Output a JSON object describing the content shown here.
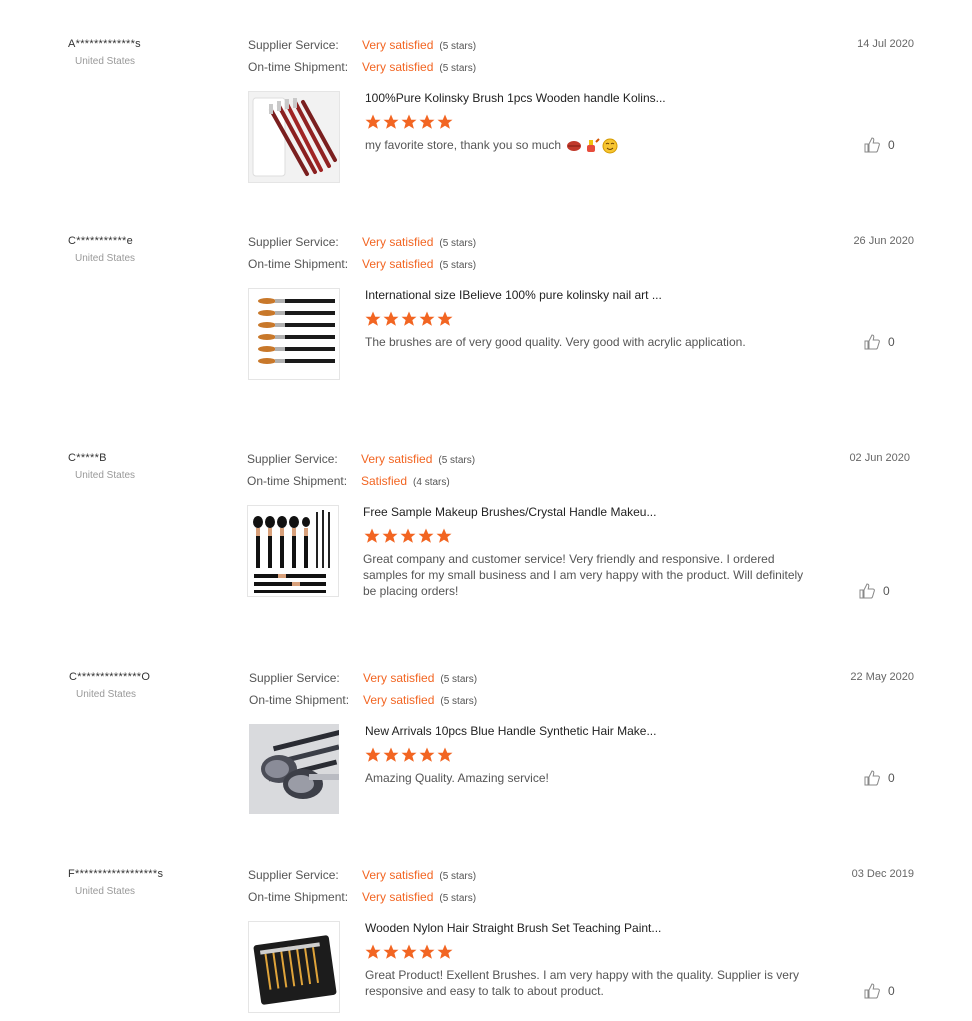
{
  "labels": {
    "supplier_service": "Supplier Service:",
    "on_time_shipment": "On-time Shipment:"
  },
  "colors": {
    "accent": "#f26522",
    "text": "#555555",
    "muted": "#999999"
  },
  "reviews": [
    {
      "buyer": "A*************s",
      "country": "United States",
      "date": "14 Jul 2020",
      "supplier_service": "Very satisfied",
      "supplier_service_stars": "(5 stars)",
      "shipment": "Very satisfied",
      "shipment_stars": "(5 stars)",
      "product_title": "100%Pure Kolinsky Brush 1pcs Wooden handle Kolins...",
      "rating": 5,
      "comment": "my favorite store, thank you so much",
      "comment_emojis": [
        "lips-emoji",
        "nail-polish-emoji",
        "blush-emoji"
      ],
      "helpful_count": "0"
    },
    {
      "buyer": "C***********e",
      "country": "United States",
      "date": "26 Jun 2020",
      "supplier_service": "Very satisfied",
      "supplier_service_stars": "(5 stars)",
      "shipment": "Very satisfied",
      "shipment_stars": "(5 stars)",
      "product_title": "International size IBelieve 100% pure kolinsky nail art ...",
      "rating": 5,
      "comment": "The brushes are of very good quality. Very good with acrylic application.",
      "helpful_count": "0"
    },
    {
      "buyer": "C*****B",
      "country": "United States",
      "date": "02 Jun 2020",
      "supplier_service": "Very satisfied",
      "supplier_service_stars": "(5 stars)",
      "shipment": "Satisfied",
      "shipment_stars": "(4 stars)",
      "product_title": "Free Sample Makeup Brushes/Crystal Handle Makeu...",
      "rating": 5,
      "comment": "Great company and customer service! Very friendly and responsive. I ordered samples for my small business and I am very happy with the product. Will definitely be placing orders!",
      "helpful_count": "0"
    },
    {
      "buyer": "C**************O",
      "country": "United States",
      "date": "22 May 2020",
      "supplier_service": "Very satisfied",
      "supplier_service_stars": "(5 stars)",
      "shipment": "Very satisfied",
      "shipment_stars": "(5 stars)",
      "product_title": "New Arrivals 10pcs Blue Handle Synthetic Hair Make...",
      "rating": 5,
      "comment": "Amazing Quality. Amazing service!",
      "helpful_count": "0"
    },
    {
      "buyer": "F******************s",
      "country": "United States",
      "date": "03 Dec 2019",
      "supplier_service": "Very satisfied",
      "supplier_service_stars": "(5 stars)",
      "shipment": "Very satisfied",
      "shipment_stars": "(5 stars)",
      "product_title": "Wooden Nylon Hair Straight Brush Set Teaching Paint...",
      "rating": 5,
      "comment": "Great Product! Exellent Brushes. I am very happy with the quality. Supplier is very responsive and easy to talk to about product.",
      "helpful_count": "0"
    }
  ]
}
